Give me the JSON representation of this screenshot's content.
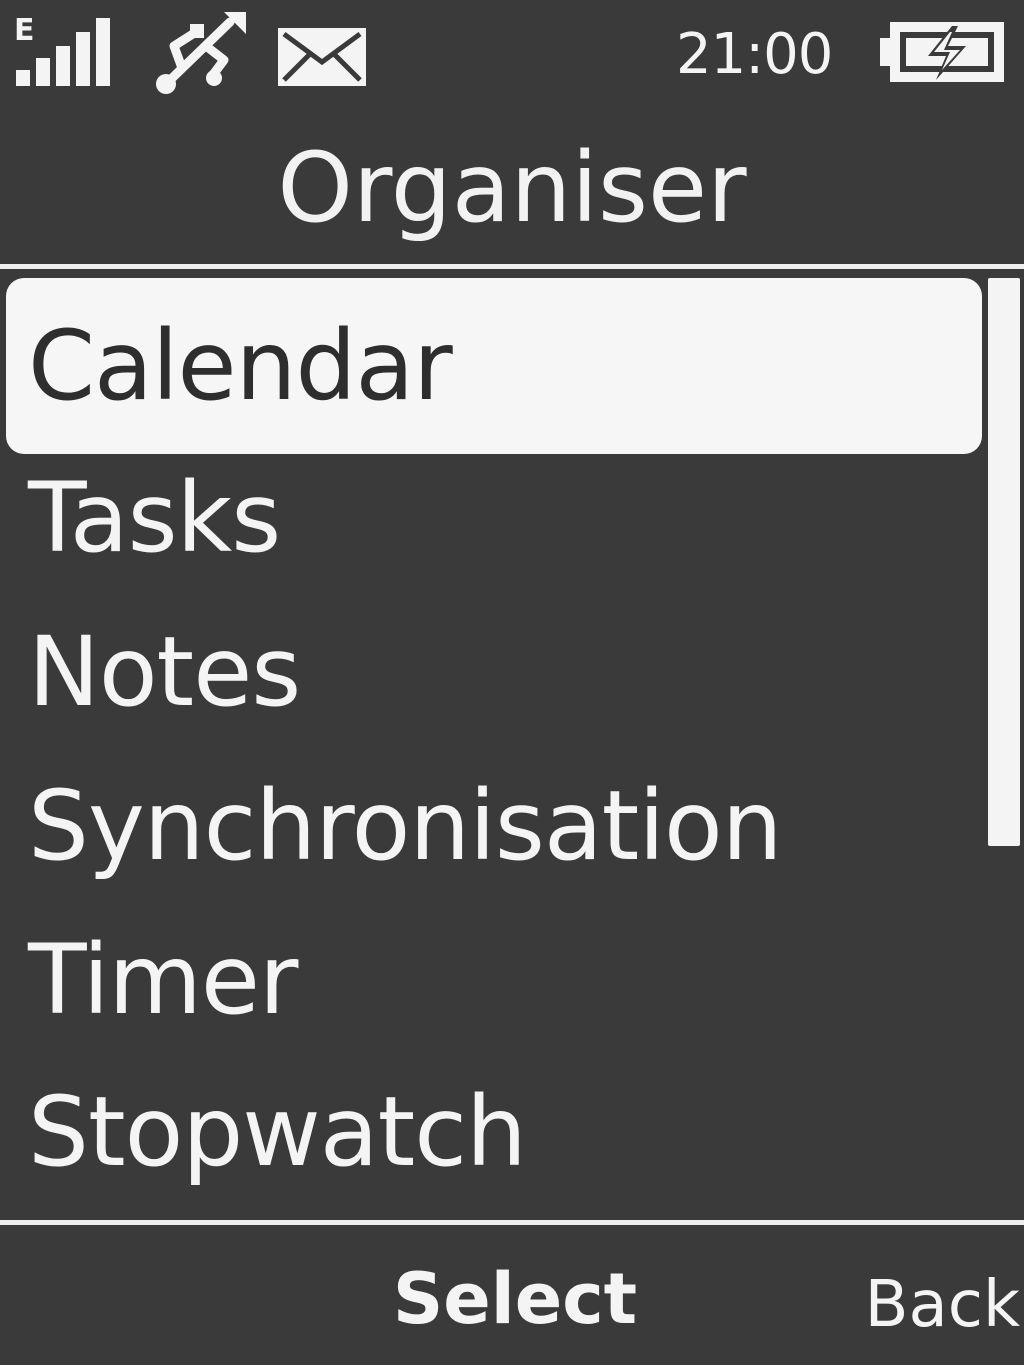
{
  "status_bar": {
    "network_type": "E",
    "signal_bars": 5,
    "time": "21:00",
    "icons": [
      "signal-icon",
      "usb-icon",
      "mail-icon",
      "battery-charging-icon"
    ]
  },
  "title": "Organiser",
  "menu": {
    "selected_index": 0,
    "items": [
      {
        "label": "Calendar"
      },
      {
        "label": "Tasks"
      },
      {
        "label": "Notes"
      },
      {
        "label": "Synchronisation"
      },
      {
        "label": "Timer"
      },
      {
        "label": "Stopwatch"
      }
    ]
  },
  "softkeys": {
    "center": "Select",
    "right": "Back"
  },
  "colors": {
    "background": "#3a3a3a",
    "foreground": "#f2f2f2",
    "highlight": "#f6f6f6",
    "highlight_text": "#2e2e2e"
  }
}
